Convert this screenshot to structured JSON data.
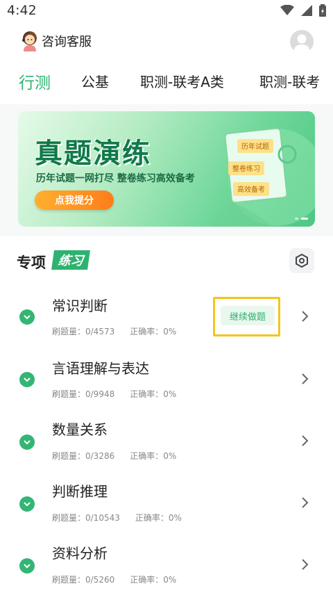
{
  "status_bar": {
    "time": "4:42"
  },
  "header": {
    "customer_service_label": "咨询客服"
  },
  "tabs": [
    {
      "label": "行测",
      "active": true
    },
    {
      "label": "公基",
      "active": false
    },
    {
      "label": "职测-联考A类",
      "active": false
    },
    {
      "label": "职测-联考",
      "active": false
    }
  ],
  "banner": {
    "title": "真题演练",
    "subtitle": "历年试题一网打尽  整卷练习高效备考",
    "button_label": "点我提分",
    "cards": [
      "历年试题",
      "整卷练习",
      "高效备考"
    ]
  },
  "section": {
    "title": "专项",
    "tag": "练习"
  },
  "practice_items": [
    {
      "title": "常识判断",
      "count_label": "刷题量：0/4573",
      "accuracy_label": "正确率：0%",
      "action": "继续做题"
    },
    {
      "title": "言语理解与表达",
      "count_label": "刷题量：0/9948",
      "accuracy_label": "正确率：0%"
    },
    {
      "title": "数量关系",
      "count_label": "刷题量：0/3286",
      "accuracy_label": "正确率：0%"
    },
    {
      "title": "判断推理",
      "count_label": "刷题量：0/10543",
      "accuracy_label": "正确率：0%"
    },
    {
      "title": "资料分析",
      "count_label": "刷题量：0/5260",
      "accuracy_label": "正确率：0%"
    }
  ],
  "colors": {
    "accent": "#2db36f",
    "highlight": "#f5c518",
    "cta": "#ff8c1f"
  }
}
